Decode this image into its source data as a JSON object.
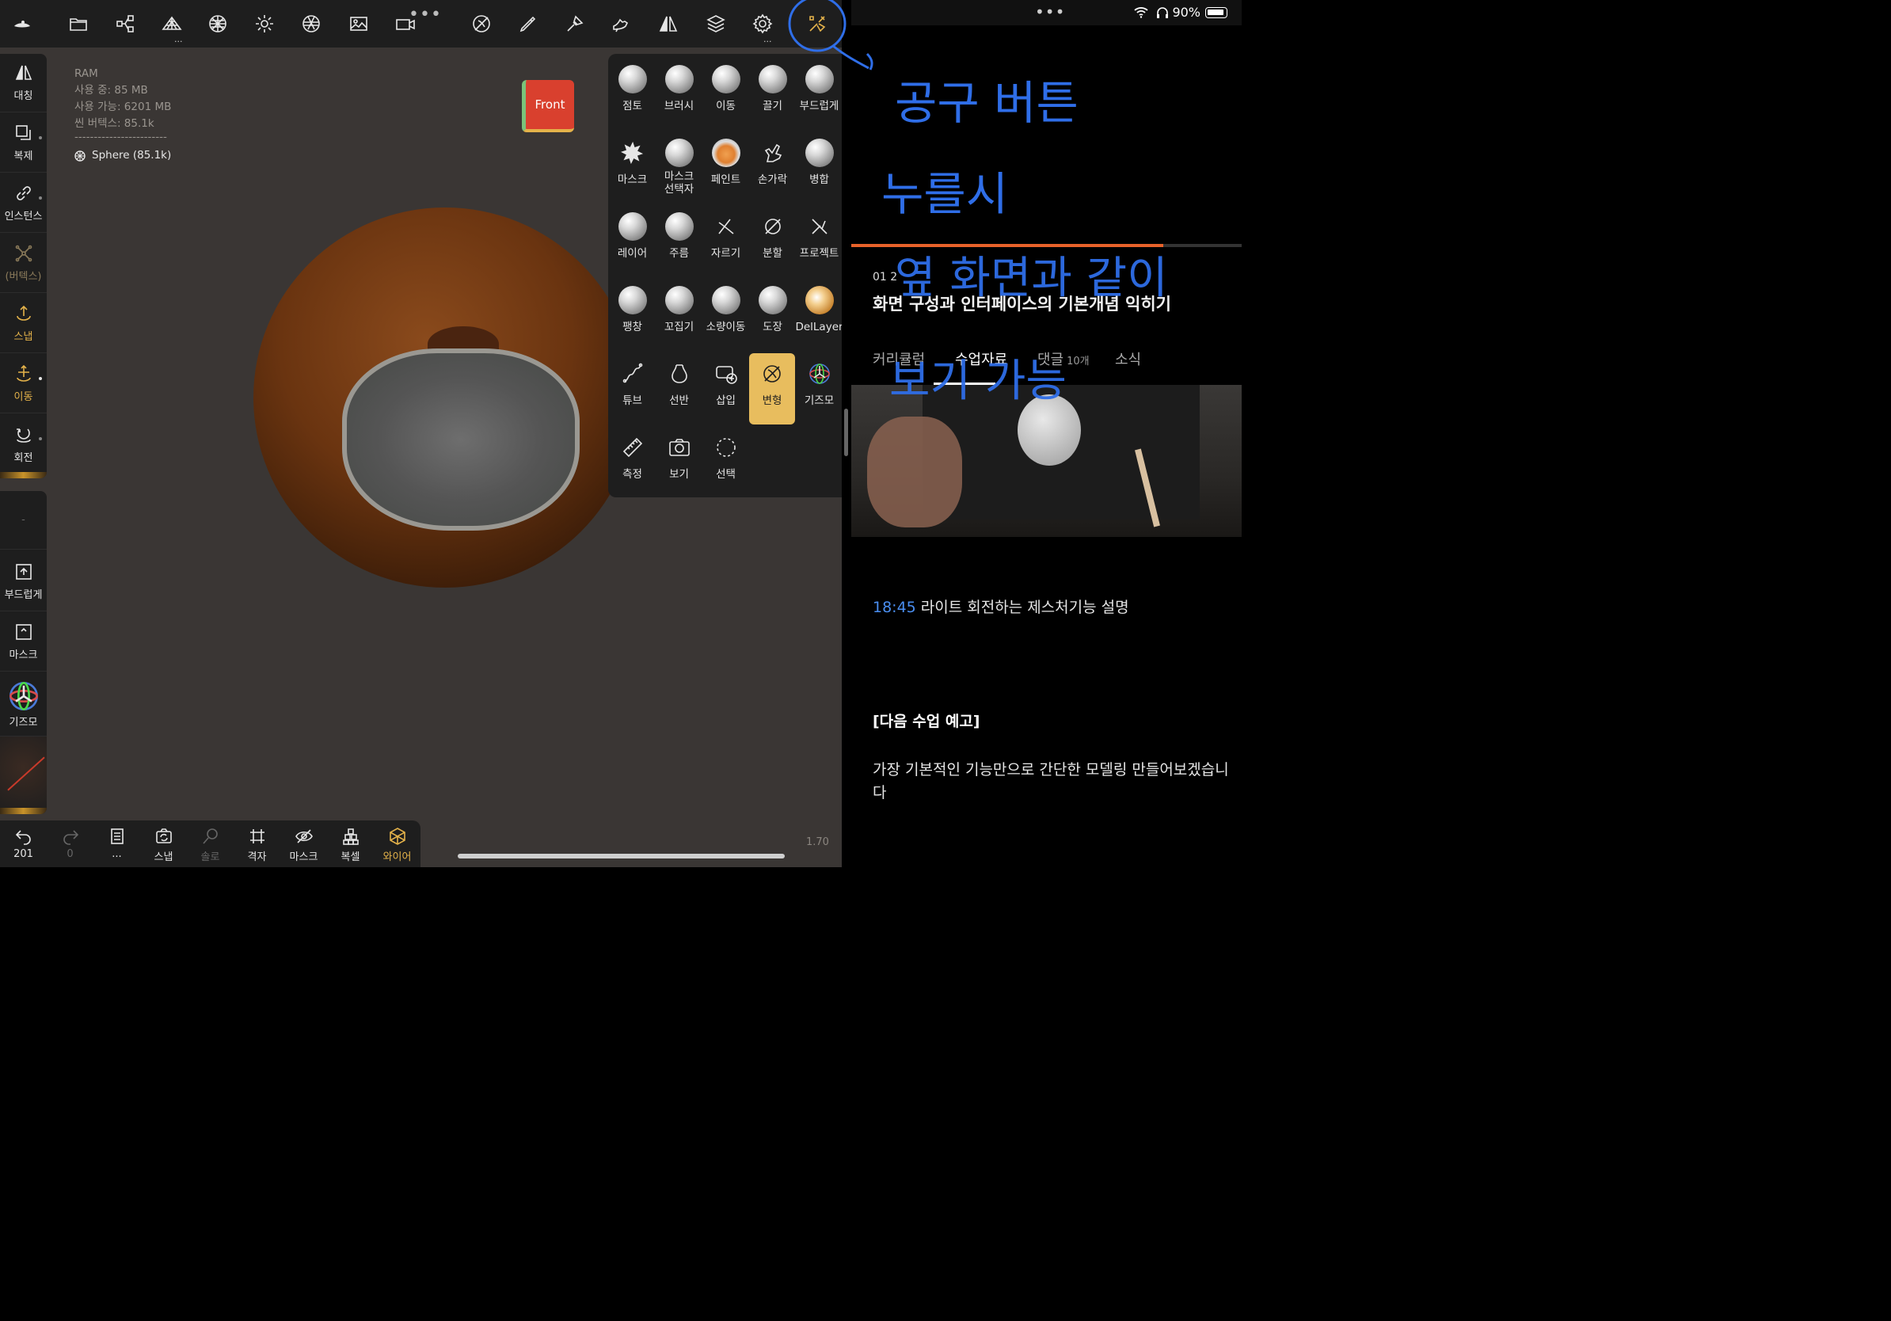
{
  "topbar": {
    "icons": [
      "nomad-logo-icon",
      "folder-icon",
      "scene-graph-icon",
      "topology-icon",
      "multiresolution-icon",
      "light-icon",
      "shading-icon",
      "background-image-icon",
      "video-icon",
      "transform-off-icon",
      "brush-icon",
      "paint-icon",
      "hand-icon",
      "symmetry-icon",
      "layers-icon",
      "settings-icon",
      "tools-icon"
    ]
  },
  "leftbar": {
    "items": [
      {
        "label": "대칭",
        "icon": "symmetry-icon"
      },
      {
        "label": "복제",
        "icon": "clone-icon"
      },
      {
        "label": "인스턴스",
        "icon": "instance-link-icon"
      },
      {
        "label": "(버텍스)",
        "icon": "vertex-icon"
      },
      {
        "label": "스냅",
        "icon": "snap-icon"
      },
      {
        "label": "이동",
        "icon": "move-icon"
      },
      {
        "label": "회전",
        "icon": "rotate-icon"
      },
      {
        "label": "-",
        "icon": ""
      },
      {
        "label": "부드럽게",
        "icon": "smooth-icon"
      },
      {
        "label": "마스크",
        "icon": "mask-icon"
      },
      {
        "label": "기즈모",
        "icon": "gizmo-icon"
      }
    ]
  },
  "stats": {
    "ram": "RAM",
    "used": "사용 중: 85 MB",
    "available": "사용 가능: 6201 MB",
    "vertices": "씬 버텍스: 85.1k",
    "divider": "------------------------",
    "mesh": "Sphere (85.1k)"
  },
  "viewcube": {
    "label": "Front"
  },
  "tools": [
    {
      "label": "점토",
      "kind": "ball"
    },
    {
      "label": "브러시",
      "kind": "ball"
    },
    {
      "label": "이동",
      "kind": "ball"
    },
    {
      "label": "끌기",
      "kind": "ball"
    },
    {
      "label": "부드럽게",
      "kind": "ball"
    },
    {
      "label": "마스크",
      "kind": "mask-splat-icon"
    },
    {
      "label": "마스크\n선택자",
      "kind": "ball"
    },
    {
      "label": "페인트",
      "kind": "ball-orange"
    },
    {
      "label": "손가락",
      "kind": "finger-icon"
    },
    {
      "label": "병합",
      "kind": "ball"
    },
    {
      "label": "레이어",
      "kind": "ball"
    },
    {
      "label": "주름",
      "kind": "ball"
    },
    {
      "label": "자르기",
      "kind": "trim-icon"
    },
    {
      "label": "분할",
      "kind": "split-icon"
    },
    {
      "label": "프로젝트",
      "kind": "project-icon"
    },
    {
      "label": "팽창",
      "kind": "ball"
    },
    {
      "label": "꼬집기",
      "kind": "ball"
    },
    {
      "label": "소량이동",
      "kind": "ball"
    },
    {
      "label": "도장",
      "kind": "ball"
    },
    {
      "label": "DelLayer",
      "kind": "ball-gold"
    },
    {
      "label": "튜브",
      "kind": "tube-icon"
    },
    {
      "label": "선반",
      "kind": "lathe-icon"
    },
    {
      "label": "삽입",
      "kind": "insert-icon"
    },
    {
      "label": "변형",
      "kind": "transform-icon",
      "active": true
    },
    {
      "label": "기즈모",
      "kind": "gizmo-icon"
    },
    {
      "label": "측정",
      "kind": "ruler-icon"
    },
    {
      "label": "보기",
      "kind": "camera-icon"
    },
    {
      "label": "선택",
      "kind": "select-icon"
    }
  ],
  "bottombar": {
    "items": [
      {
        "label": "201",
        "icon": "undo-icon"
      },
      {
        "label": "0",
        "icon": "redo-icon"
      },
      {
        "label": "...",
        "icon": "history-icon"
      },
      {
        "label": "스냅",
        "icon": "snap-camera-icon"
      },
      {
        "label": "솔로",
        "icon": "solo-icon"
      },
      {
        "label": "격자",
        "icon": "grid-icon"
      },
      {
        "label": "마스크",
        "icon": "hide-mask-icon"
      },
      {
        "label": "복셀",
        "icon": "voxel-icon"
      },
      {
        "label": "와이어",
        "icon": "wireframe-icon"
      }
    ]
  },
  "zoom_value": "1.70",
  "right": {
    "status": {
      "battery": "90%"
    },
    "annotation": [
      "공구 버튼",
      "누를시",
      "옆 화면과 같이",
      "보기 가능"
    ],
    "progress": 0.8,
    "lesson_num": "01   2",
    "lesson_title": "화면 구성과 인터페이스의 기본개념 익히기",
    "tabs": [
      {
        "label": "커리큘럼"
      },
      {
        "label": "수업자료"
      },
      {
        "label": "댓글",
        "count": "10개"
      },
      {
        "label": "소식"
      }
    ],
    "chapter_time": "18:45",
    "chapter_text": "라이트 회전하는 제스처기능 설명",
    "next_heading": "[다음 수업 예고]",
    "next_body": "가장 기본적인 기능만으로 간단한 모델링 만들어보겠습니다"
  }
}
